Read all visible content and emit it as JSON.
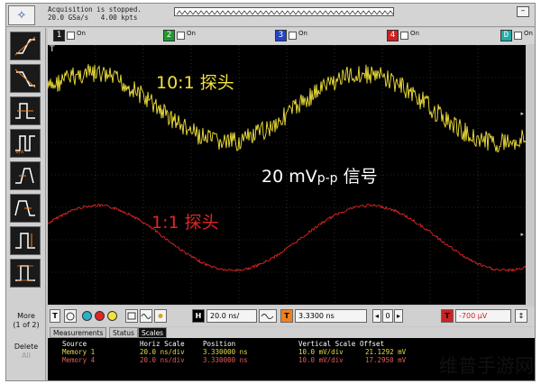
{
  "header": {
    "acquisition_status": "Acquisition is stopped.",
    "sample_rate": "20.0 GSa/s",
    "record_length": "4.00 kpts",
    "window_button": "–"
  },
  "channels": [
    {
      "label": "1",
      "state": "On",
      "color": "#1a1a1a"
    },
    {
      "label": "2",
      "state": "On",
      "color": "#1f9b2e"
    },
    {
      "label": "3",
      "state": "On",
      "color": "#2244cc"
    },
    {
      "label": "4",
      "state": "On",
      "color": "#cc2222"
    },
    {
      "label": "D",
      "state": "On",
      "color": "#22aaaa"
    }
  ],
  "display": {
    "label_yellow": "10:1 探头",
    "label_white_main": "20 mV",
    "label_white_sub": "p-p",
    "label_white_tail": " 信号",
    "label_red": "1:1 探头",
    "trigger_marker": "T",
    "yellow_color": "#f2e23a",
    "red_color": "#e02525"
  },
  "toolbar": {
    "more_label": "More",
    "more_sub": "(1 of 2)",
    "delete_label": "Delete",
    "delete_sub": "All"
  },
  "controls": {
    "trigger_icon": "T",
    "h_label": "H",
    "h_scale": "20.0 ns/",
    "t_label": "T",
    "t_position": "3.3300 ns",
    "stepper_left": "◂",
    "stepper_val": "0",
    "stepper_right": "▸",
    "trig_label": "T",
    "trig_level": "-700 μV"
  },
  "tabs": [
    "Measurements",
    "Status",
    "Scales"
  ],
  "scales": {
    "headers": [
      "Source",
      "Horiz Scale",
      "Position",
      "Vertical Scale",
      "Offset"
    ],
    "rows": [
      {
        "source": "Memory 1",
        "horiz": "20.0 ns/div",
        "position": "3.330000 ns",
        "vertical": "10.0 mV/div",
        "offset": "21.1292 mV"
      },
      {
        "source": "Memory 4",
        "horiz": "20.0 ns/div",
        "position": "3.330000 ns",
        "vertical": "10.0 mV/div",
        "offset": "17.2950 mV"
      }
    ]
  },
  "watermark": "维普手游网"
}
